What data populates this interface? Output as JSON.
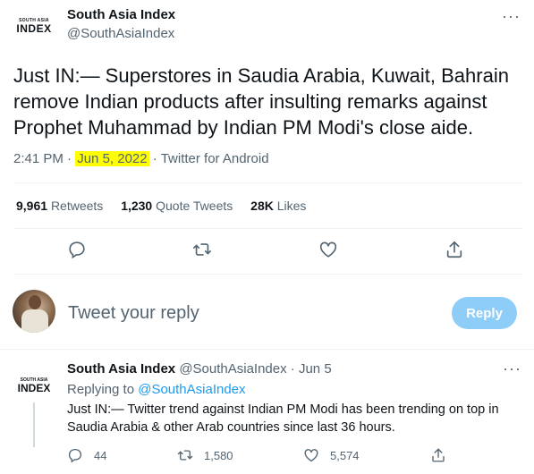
{
  "main_tweet": {
    "author_name": "South Asia Index",
    "author_handle": "@SouthAsiaIndex",
    "logo_small": "SOUTH ASIA",
    "logo_big": "INDEX",
    "more": "···",
    "text": "Just IN:— Superstores in Saudia Arabia, Kuwait, Bahrain remove Indian products after insulting remarks against Prophet Muhammad by Indian PM Modi's close aide.",
    "time": "2:41 PM",
    "sep1": " · ",
    "date": "Jun 5, 2022",
    "sep2": " · ",
    "source": "Twitter for Android",
    "highlight_color": "#ffff00"
  },
  "stats": {
    "retweets_count": "9,961",
    "retweets_label": "Retweets",
    "quotes_count": "1,230",
    "quotes_label": "Quote Tweets",
    "likes_count": "28K",
    "likes_label": "Likes"
  },
  "actions": [
    "reply-icon",
    "retweet-icon",
    "like-icon",
    "share-icon"
  ],
  "reply_box": {
    "placeholder": "Tweet your reply",
    "button_label": "Reply",
    "button_color": "#8ecdf8"
  },
  "reply_tweet": {
    "author_name": "South Asia Index",
    "author_handle": "@SouthAsiaIndex",
    "dot": " · ",
    "date": "Jun 5",
    "more": "···",
    "replying_prefix": "Replying to ",
    "replying_to": "@SouthAsiaIndex",
    "text": "Just IN:— Twitter trend against Indian PM Modi has been trending on top in Saudia Arabia & other Arab countries since last 36 hours.",
    "replies": "44",
    "retweets": "1,580",
    "likes": "5,574"
  },
  "colors": {
    "accent": "#1d9bf0",
    "muted": "#536471"
  }
}
